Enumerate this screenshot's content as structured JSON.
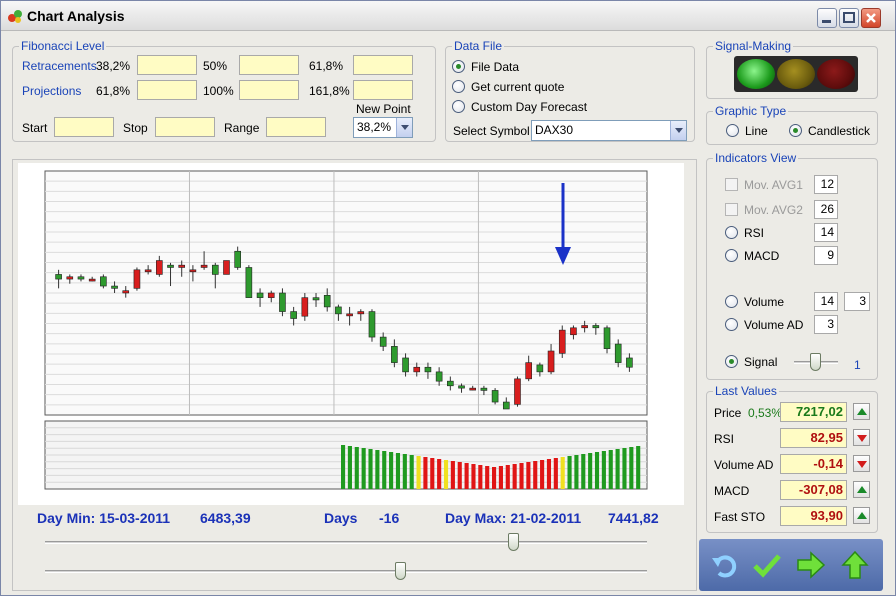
{
  "window": {
    "title": "Chart Analysis"
  },
  "fibonacci": {
    "title": "Fibonacci Level",
    "retracements_label": "Retracements",
    "projections_label": "Projections",
    "retracement_levels": [
      "38,2%",
      "50%",
      "61,8%"
    ],
    "projection_levels": [
      "61,8%",
      "100%",
      "161,8%"
    ],
    "start_label": "Start",
    "stop_label": "Stop",
    "range_label": "Range",
    "new_point_label": "New Point",
    "new_point_value": "38,2%"
  },
  "data_file": {
    "title": "Data File",
    "options": [
      "File Data",
      "Get current quote",
      "Custom Day Forecast"
    ],
    "selected": 0,
    "symbol_label": "Select Symbol",
    "symbol_value": "DAX30"
  },
  "signal_making": {
    "title": "Signal-Making",
    "lamps": [
      "#2db82d",
      "#7a6a10",
      "#6e1010"
    ]
  },
  "graphic_type": {
    "title": "Graphic Type",
    "options": [
      "Line",
      "Candlestick"
    ],
    "selected": 1
  },
  "indicators": {
    "title": "Indicators View",
    "mov_avg1_label": "Mov. AVG1",
    "mov_avg1_value": "12",
    "mov_avg2_label": "Mov. AVG2",
    "mov_avg2_value": "26",
    "rsi_label": "RSI",
    "rsi_value": "14",
    "macd_label": "MACD",
    "macd_value": "9",
    "volume_label": "Volume",
    "volume_value1": "14",
    "volume_value2": "3",
    "volume_ad_label": "Volume AD",
    "volume_ad_value": "3",
    "signal_label": "Signal",
    "signal_value": "1"
  },
  "last_values": {
    "title": "Last Values",
    "rows": [
      {
        "label": "Price",
        "extra": "0,53%",
        "value": "7217,02",
        "color": "#1a7a1a",
        "trend": "up"
      },
      {
        "label": "RSI",
        "extra": "",
        "value": "82,95",
        "color": "#b01010",
        "trend": "down"
      },
      {
        "label": "Volume AD",
        "extra": "",
        "value": "-0,14",
        "color": "#b01010",
        "trend": "down"
      },
      {
        "label": "MACD",
        "extra": "",
        "value": "-307,08",
        "color": "#b01010",
        "trend": "up"
      },
      {
        "label": "Fast STO",
        "extra": "",
        "value": "93,90",
        "color": "#b01010",
        "trend": "up"
      }
    ]
  },
  "info": {
    "day_min": "Day Min: 15-03-2011",
    "min_value": "6483,39",
    "days_label": "Days",
    "days_value": "-16",
    "day_max": "Day Max: 21-02-2011",
    "max_value": "7441,82"
  },
  "toolbar": {
    "icons": [
      "undo-icon",
      "check-icon",
      "forward-arrow-icon",
      "up-arrow-icon"
    ]
  },
  "chart_data": {
    "type": "candlestick",
    "colors": {
      "up": "#2e9a2e",
      "down": "#d81e1e",
      "neutral": "#e8e020"
    },
    "candles": [
      {
        "o": 0.58,
        "c": 0.56,
        "h": 0.52,
        "l": 0.6
      },
      {
        "o": 0.56,
        "c": 0.57,
        "h": 0.54,
        "l": 0.58
      },
      {
        "o": 0.57,
        "c": 0.56,
        "h": 0.55,
        "l": 0.58
      },
      {
        "o": 0.56,
        "c": 0.56,
        "h": 0.55,
        "l": 0.57
      },
      {
        "o": 0.57,
        "c": 0.53,
        "h": 0.52,
        "l": 0.58
      },
      {
        "o": 0.53,
        "c": 0.52,
        "h": 0.5,
        "l": 0.55
      },
      {
        "o": 0.5,
        "c": 0.51,
        "h": 0.48,
        "l": 0.53
      },
      {
        "o": 0.52,
        "c": 0.6,
        "h": 0.51,
        "l": 0.61
      },
      {
        "o": 0.6,
        "c": 0.6,
        "h": 0.58,
        "l": 0.62
      },
      {
        "o": 0.58,
        "c": 0.64,
        "h": 0.57,
        "l": 0.66
      },
      {
        "o": 0.62,
        "c": 0.61,
        "h": 0.53,
        "l": 0.63
      },
      {
        "o": 0.61,
        "c": 0.62,
        "h": 0.57,
        "l": 0.64
      },
      {
        "o": 0.6,
        "c": 0.6,
        "h": 0.55,
        "l": 0.62
      },
      {
        "o": 0.61,
        "c": 0.62,
        "h": 0.6,
        "l": 0.68
      },
      {
        "o": 0.62,
        "c": 0.58,
        "h": 0.52,
        "l": 0.63
      },
      {
        "o": 0.58,
        "c": 0.64,
        "h": 0.58,
        "l": 0.64
      },
      {
        "o": 0.68,
        "c": 0.61,
        "h": 0.6,
        "l": 0.7
      },
      {
        "o": 0.61,
        "c": 0.48,
        "h": 0.48,
        "l": 0.62
      },
      {
        "o": 0.5,
        "c": 0.48,
        "h": 0.44,
        "l": 0.52
      },
      {
        "o": 0.48,
        "c": 0.5,
        "h": 0.46,
        "l": 0.51
      },
      {
        "o": 0.5,
        "c": 0.42,
        "h": 0.4,
        "l": 0.52
      },
      {
        "o": 0.42,
        "c": 0.39,
        "h": 0.36,
        "l": 0.44
      },
      {
        "o": 0.4,
        "c": 0.48,
        "h": 0.38,
        "l": 0.5
      },
      {
        "o": 0.48,
        "c": 0.47,
        "h": 0.44,
        "l": 0.5
      },
      {
        "o": 0.49,
        "c": 0.44,
        "h": 0.42,
        "l": 0.52
      },
      {
        "o": 0.44,
        "c": 0.41,
        "h": 0.38,
        "l": 0.45
      },
      {
        "o": 0.41,
        "c": 0.41,
        "h": 0.36,
        "l": 0.44
      },
      {
        "o": 0.41,
        "c": 0.42,
        "h": 0.38,
        "l": 0.43
      },
      {
        "o": 0.42,
        "c": 0.31,
        "h": 0.29,
        "l": 0.43
      },
      {
        "o": 0.31,
        "c": 0.27,
        "h": 0.25,
        "l": 0.33
      },
      {
        "o": 0.27,
        "c": 0.2,
        "h": 0.18,
        "l": 0.3
      },
      {
        "o": 0.22,
        "c": 0.16,
        "h": 0.14,
        "l": 0.24
      },
      {
        "o": 0.16,
        "c": 0.18,
        "h": 0.14,
        "l": 0.2
      },
      {
        "o": 0.18,
        "c": 0.16,
        "h": 0.13,
        "l": 0.2
      },
      {
        "o": 0.16,
        "c": 0.12,
        "h": 0.1,
        "l": 0.18
      },
      {
        "o": 0.12,
        "c": 0.1,
        "h": 0.08,
        "l": 0.14
      },
      {
        "o": 0.1,
        "c": 0.09,
        "h": 0.07,
        "l": 0.11
      },
      {
        "o": 0.09,
        "c": 0.09,
        "h": 0.08,
        "l": 0.1
      },
      {
        "o": 0.09,
        "c": 0.08,
        "h": 0.06,
        "l": 0.1
      },
      {
        "o": 0.08,
        "c": 0.03,
        "h": 0.02,
        "l": 0.09
      },
      {
        "o": 0.03,
        "c": 0.0,
        "h": 0.0,
        "l": 0.05
      },
      {
        "o": 0.02,
        "c": 0.13,
        "h": 0.01,
        "l": 0.14
      },
      {
        "o": 0.13,
        "c": 0.2,
        "h": 0.12,
        "l": 0.23
      },
      {
        "o": 0.19,
        "c": 0.16,
        "h": 0.14,
        "l": 0.2
      },
      {
        "o": 0.16,
        "c": 0.25,
        "h": 0.15,
        "l": 0.28
      },
      {
        "o": 0.24,
        "c": 0.34,
        "h": 0.22,
        "l": 0.36
      },
      {
        "o": 0.32,
        "c": 0.35,
        "h": 0.3,
        "l": 0.36
      },
      {
        "o": 0.35,
        "c": 0.36,
        "h": 0.33,
        "l": 0.38
      },
      {
        "o": 0.36,
        "c": 0.35,
        "h": 0.32,
        "l": 0.37
      },
      {
        "o": 0.35,
        "c": 0.26,
        "h": 0.24,
        "l": 0.36
      },
      {
        "o": 0.28,
        "c": 0.2,
        "h": 0.18,
        "l": 0.3
      },
      {
        "o": 0.22,
        "c": 0.18,
        "h": 0.16,
        "l": 0.24
      }
    ],
    "volume_colors": [
      "g",
      "g",
      "g",
      "g",
      "g",
      "g",
      "g",
      "g",
      "g",
      "g",
      "g",
      "y",
      "r",
      "r",
      "r",
      "y",
      "r",
      "r",
      "r",
      "r",
      "r",
      "r",
      "r",
      "r",
      "r",
      "r",
      "r",
      "r",
      "r",
      "r",
      "r",
      "r",
      "y",
      "g",
      "g",
      "g",
      "g",
      "g",
      "g",
      "g",
      "g",
      "g",
      "g",
      "g"
    ]
  }
}
